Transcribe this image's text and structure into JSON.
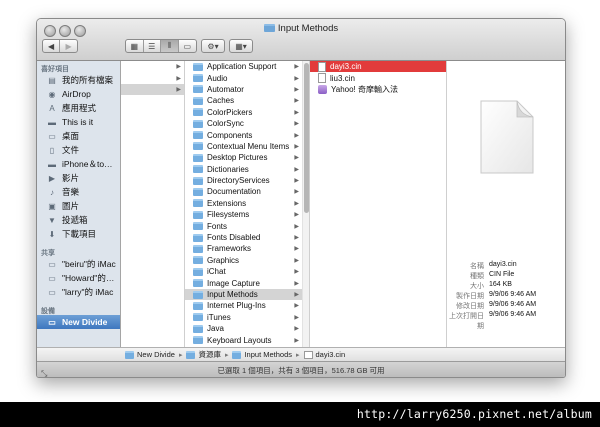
{
  "window": {
    "title": "Input Methods",
    "back_label": "◀",
    "forward_label": "▶",
    "action_label": "⚙▾",
    "arrange_label": "▦▾"
  },
  "sidebar": {
    "favorites_header": "喜好項目",
    "favorites": [
      {
        "label": "我的所有檔案",
        "icon": "all-files-icon"
      },
      {
        "label": "AirDrop",
        "icon": "airdrop-icon"
      },
      {
        "label": "應用程式",
        "icon": "applications-icon"
      },
      {
        "label": "This is it",
        "icon": "folder-icon"
      },
      {
        "label": "桌面",
        "icon": "desktop-icon"
      },
      {
        "label": "文件",
        "icon": "documents-icon"
      },
      {
        "label": "iPhone＆to…",
        "icon": "folder-icon"
      },
      {
        "label": "影片",
        "icon": "movies-icon"
      },
      {
        "label": "音樂",
        "icon": "music-icon"
      },
      {
        "label": "圖片",
        "icon": "pictures-icon"
      },
      {
        "label": "投遞箱",
        "icon": "dropbox-icon"
      },
      {
        "label": "下載項目",
        "icon": "downloads-icon"
      }
    ],
    "shared_header": "共享",
    "shared": [
      {
        "label": "\"beiru\"的 iMac",
        "icon": "imac-icon"
      },
      {
        "label": "\"Howard\"的…",
        "icon": "imac-icon"
      },
      {
        "label": "\"larry\"的 iMac",
        "icon": "imac-icon"
      }
    ],
    "devices_header": "設備",
    "devices": [
      {
        "label": "New Divide",
        "icon": "hard-drive-icon",
        "selected": true
      }
    ]
  },
  "column_library": {
    "items": [
      "Application Support",
      "Audio",
      "Automator",
      "Caches",
      "ColorPickers",
      "ColorSync",
      "Components",
      "Contextual Menu Items",
      "Desktop Pictures",
      "Dictionaries",
      "DirectoryServices",
      "Documentation",
      "Extensions",
      "Filesystems",
      "Fonts",
      "Fonts Disabled",
      "Frameworks",
      "Graphics",
      "iChat",
      "Image Capture",
      "Input Methods",
      "Internet Plug-Ins",
      "iTunes",
      "Java",
      "Keyboard Layouts"
    ],
    "highlighted": "Input Methods"
  },
  "column_files": {
    "items": [
      {
        "label": "dayi3.cin",
        "kind": "doc",
        "selected": true
      },
      {
        "label": "liu3.cin",
        "kind": "doc",
        "selected": false
      },
      {
        "label": "Yahoo! 奇摩輸入法",
        "kind": "app",
        "selected": false
      }
    ]
  },
  "preview": {
    "rows": [
      {
        "key": "名稱",
        "value": "dayi3.cin"
      },
      {
        "key": "種類",
        "value": "CIN File"
      },
      {
        "key": "大小",
        "value": "164 KB"
      },
      {
        "key": "製作日期",
        "value": "9/9/06 9:46 AM"
      },
      {
        "key": "修改日期",
        "value": "9/9/06 9:46 AM"
      },
      {
        "key": "上次打開日期",
        "value": "9/9/06 9:46 AM"
      }
    ]
  },
  "pathbar": {
    "segments": [
      "New Divide",
      "資源庫",
      "Input Methods",
      "dayi3.cin"
    ]
  },
  "status": {
    "text": "已選取 1 個項目，共有 3 個項目，516.78 GB 可用"
  },
  "watermark": {
    "text": "http://larry6250.pixnet.net/album"
  }
}
